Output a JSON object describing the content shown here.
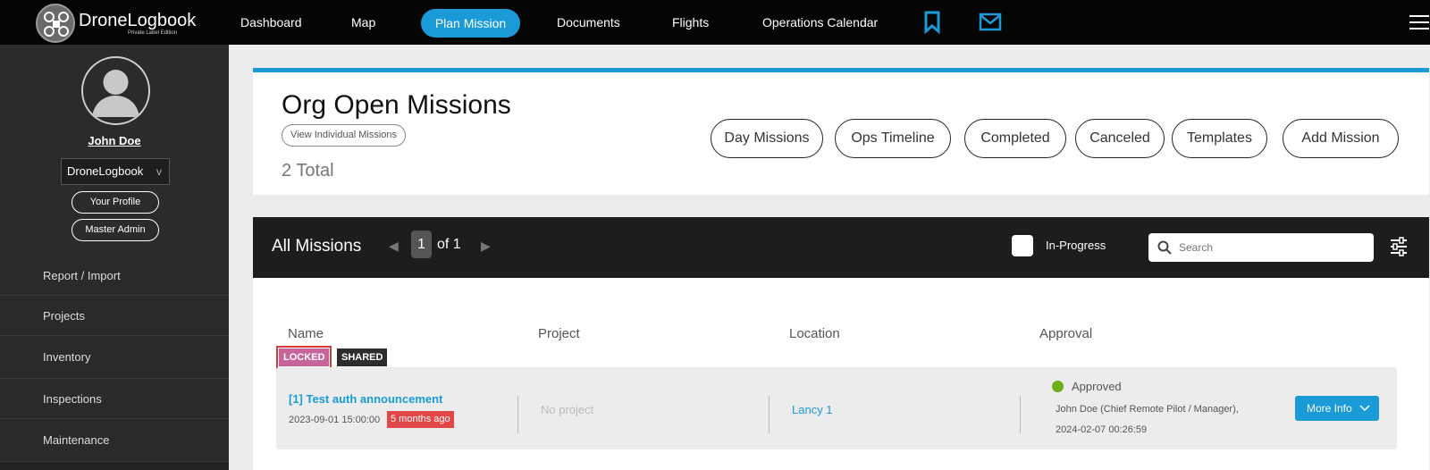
{
  "brand": {
    "name": "DroneLogbook",
    "edition": "Private Label Edition"
  },
  "nav": {
    "items": [
      "Dashboard",
      "Map",
      "Plan Mission",
      "Documents",
      "Flights",
      "Operations Calendar"
    ],
    "active": "Plan Mission",
    "icons": [
      "bookmark-icon",
      "mail-icon",
      "menu-icon"
    ],
    "accent": "#1a9ad6"
  },
  "sidebar": {
    "user": "John Doe",
    "org": "DroneLogbook",
    "org_chevron": "v",
    "profile_btn": "Your Profile",
    "admin_btn": "Master Admin",
    "items": [
      "Report / Import",
      "Projects",
      "Inventory",
      "Inspections",
      "Maintenance"
    ]
  },
  "header": {
    "title": "Org Open Missions",
    "view_individual": "View Individual Missions",
    "total": "2 Total",
    "buttons": [
      "Day Missions",
      "Ops Timeline",
      "Completed",
      "Canceled",
      "Templates",
      "Add Mission"
    ]
  },
  "missions": {
    "title": "All Missions",
    "page": "1",
    "of": "of 1",
    "in_progress": "In-Progress",
    "search_placeholder": "Search",
    "columns": [
      "Name",
      "Project",
      "Location",
      "Approval"
    ],
    "rows": [
      {
        "tags": [
          "LOCKED",
          "SHARED"
        ],
        "name": "[1] Test auth announcement",
        "date": "2023-09-01 15:00:00",
        "age": "5 months ago",
        "project": "No project",
        "location": "Lancy 1",
        "status": "Approved",
        "status_color": "#6bae1a",
        "approver": "John Doe (Chief Remote Pilot / Manager),",
        "approved_at": "2024-02-07 00:26:59",
        "action": "More Info"
      }
    ]
  }
}
